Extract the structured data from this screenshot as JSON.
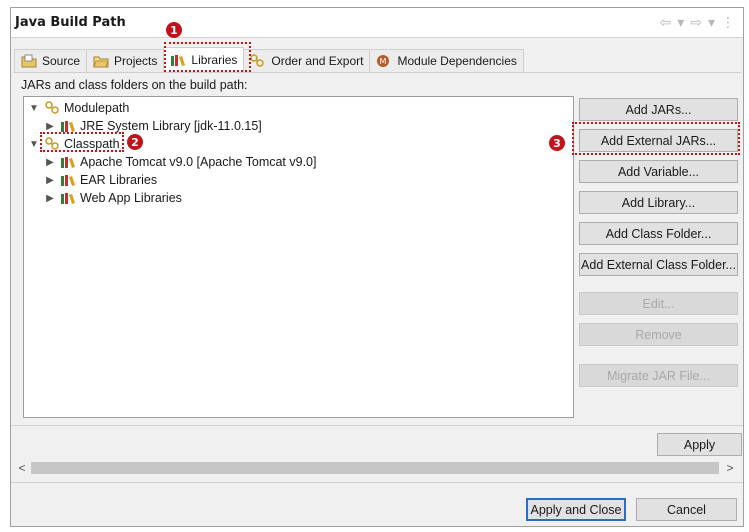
{
  "window": {
    "title": "Java Build Path",
    "nav": {
      "back_icon": "⇦",
      "dropdown_icon": "▾",
      "forward_icon": "⇨",
      "menu_icon": "⋮"
    }
  },
  "tabs": [
    {
      "label": "Source",
      "icon": "source-folder-icon",
      "active": false
    },
    {
      "label": "Projects",
      "icon": "projects-icon",
      "active": false
    },
    {
      "label": "Libraries",
      "icon": "library-icon",
      "active": true
    },
    {
      "label": "Order and Export",
      "icon": "order-export-icon",
      "active": false
    },
    {
      "label": "Module Dependencies",
      "icon": "module-dependencies-icon",
      "active": false
    }
  ],
  "build_path_label": "JARs and class folders on the build path:",
  "tree": {
    "modulepath": {
      "label": "Modulepath",
      "children": [
        {
          "label": "JRE System Library [jdk-11.0.15]"
        }
      ]
    },
    "classpath": {
      "label": "Classpath",
      "children": [
        {
          "label": "Apache Tomcat v9.0 [Apache Tomcat v9.0]"
        },
        {
          "label": "EAR Libraries"
        },
        {
          "label": "Web App Libraries"
        }
      ]
    }
  },
  "buttons": {
    "add_jars": "Add JARs...",
    "add_external_jars": "Add External JARs...",
    "add_variable": "Add Variable...",
    "add_library": "Add Library...",
    "add_class_folder": "Add Class Folder...",
    "add_external_class_folder": "Add External Class Folder...",
    "edit": "Edit...",
    "remove": "Remove",
    "migrate_jar": "Migrate JAR File..."
  },
  "apply": "Apply",
  "scroll": {
    "left": "<",
    "right": ">"
  },
  "footer": {
    "apply_close": "Apply and Close",
    "cancel": "Cancel"
  },
  "markers": {
    "one": "1",
    "two": "2",
    "three": "3"
  },
  "colors": {
    "highlight": "#cc1111",
    "marker": "#c0141a",
    "primary_border": "#2b6cc4"
  }
}
